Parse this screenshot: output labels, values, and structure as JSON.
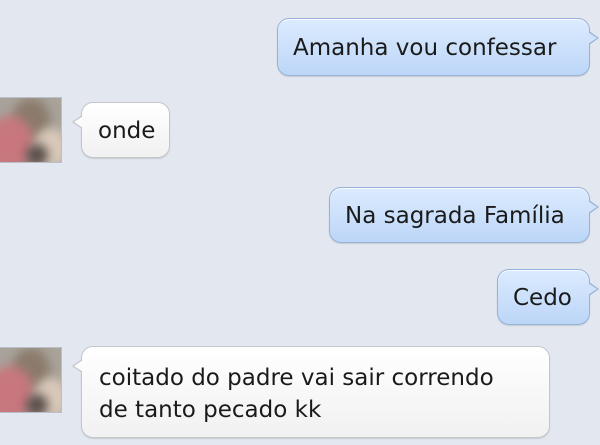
{
  "conversation": {
    "messages": [
      {
        "direction": "outgoing",
        "text": "Amanha vou confessar"
      },
      {
        "direction": "incoming",
        "text": "onde"
      },
      {
        "direction": "outgoing",
        "text": "Na sagrada Família"
      },
      {
        "direction": "outgoing",
        "text": "Cedo"
      },
      {
        "direction": "incoming",
        "lines": [
          "coitado do padre vai sair correndo",
          "de tanto pecado kk"
        ]
      }
    ]
  },
  "colors": {
    "background": "#e3e7ef",
    "outgoing_bubble": "#c9defa",
    "incoming_bubble": "#ffffff"
  }
}
